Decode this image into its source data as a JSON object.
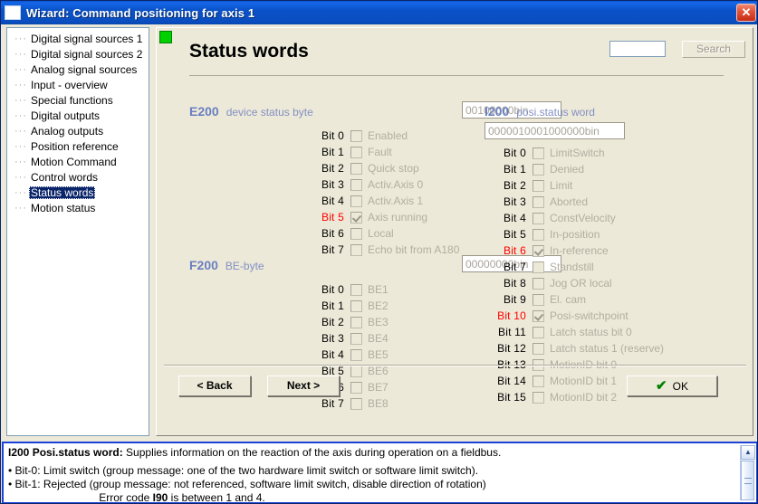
{
  "window": {
    "title": "Wizard: Command positioning for axis 1",
    "close_label": "✕"
  },
  "sidebar": {
    "items": [
      {
        "label": "Digital signal sources 1",
        "selected": false
      },
      {
        "label": "Digital signal sources 2",
        "selected": false
      },
      {
        "label": "Analog signal sources",
        "selected": false
      },
      {
        "label": "Input - overview",
        "selected": false
      },
      {
        "label": "Special functions",
        "selected": false
      },
      {
        "label": "Digital outputs",
        "selected": false
      },
      {
        "label": "Analog outputs",
        "selected": false
      },
      {
        "label": "Position reference",
        "selected": false
      },
      {
        "label": "Motion Command",
        "selected": false
      },
      {
        "label": "Control words",
        "selected": false
      },
      {
        "label": "Status words",
        "selected": true
      },
      {
        "label": "Motion status",
        "selected": false
      }
    ]
  },
  "page": {
    "title": "Status words",
    "led_color": "#00d000",
    "search": {
      "value": "",
      "button_label": "Search"
    }
  },
  "groups": {
    "e200": {
      "code": "E200",
      "description": "device status byte",
      "value": "00100000bin",
      "bits": [
        {
          "label": "Bit  0",
          "name": "Enabled",
          "checked": false,
          "highlight": false
        },
        {
          "label": "Bit  1",
          "name": "Fault",
          "checked": false,
          "highlight": false
        },
        {
          "label": "Bit  2",
          "name": "Quick stop",
          "checked": false,
          "highlight": false
        },
        {
          "label": "Bit  3",
          "name": "Activ.Axis 0",
          "checked": false,
          "highlight": false
        },
        {
          "label": "Bit  4",
          "name": "Activ.Axis 1",
          "checked": false,
          "highlight": false
        },
        {
          "label": "Bit  5",
          "name": "Axis running",
          "checked": true,
          "highlight": true
        },
        {
          "label": "Bit  6",
          "name": "Local",
          "checked": false,
          "highlight": false
        },
        {
          "label": "Bit  7",
          "name": "Echo bit from A180",
          "checked": false,
          "highlight": false
        }
      ]
    },
    "f200": {
      "code": "F200",
      "description": "BE-byte",
      "value": "00000000bin",
      "bits": [
        {
          "label": "Bit  0",
          "name": "BE1",
          "checked": false,
          "highlight": false
        },
        {
          "label": "Bit  1",
          "name": "BE2",
          "checked": false,
          "highlight": false
        },
        {
          "label": "Bit  2",
          "name": "BE3",
          "checked": false,
          "highlight": false
        },
        {
          "label": "Bit  3",
          "name": "BE4",
          "checked": false,
          "highlight": false
        },
        {
          "label": "Bit  4",
          "name": "BE5",
          "checked": false,
          "highlight": false
        },
        {
          "label": "Bit  5",
          "name": "BE6",
          "checked": false,
          "highlight": false
        },
        {
          "label": "Bit  6",
          "name": "BE7",
          "checked": false,
          "highlight": false
        },
        {
          "label": "Bit  7",
          "name": "BE8",
          "checked": false,
          "highlight": false
        }
      ]
    },
    "i200": {
      "code": "I200",
      "description": "posi.status word",
      "value": "0000010001000000bin",
      "bits": [
        {
          "label": "Bit  0",
          "name": "LimitSwitch",
          "checked": false,
          "highlight": false
        },
        {
          "label": "Bit  1",
          "name": "Denied",
          "checked": false,
          "highlight": false
        },
        {
          "label": "Bit  2",
          "name": "Limit",
          "checked": false,
          "highlight": false
        },
        {
          "label": "Bit  3",
          "name": "Aborted",
          "checked": false,
          "highlight": false
        },
        {
          "label": "Bit  4",
          "name": "ConstVelocity",
          "checked": false,
          "highlight": false
        },
        {
          "label": "Bit  5",
          "name": "In-position",
          "checked": false,
          "highlight": false
        },
        {
          "label": "Bit  6",
          "name": "In-reference",
          "checked": true,
          "highlight": true
        },
        {
          "label": "Bit  7",
          "name": "Standstill",
          "checked": false,
          "highlight": false
        },
        {
          "label": "Bit  8",
          "name": "Jog OR local",
          "checked": false,
          "highlight": false
        },
        {
          "label": "Bit  9",
          "name": "El. cam",
          "checked": false,
          "highlight": false
        },
        {
          "label": "Bit 10",
          "name": "Posi-switchpoint",
          "checked": true,
          "highlight": true
        },
        {
          "label": "Bit 11",
          "name": "Latch status bit 0",
          "checked": false,
          "highlight": false
        },
        {
          "label": "Bit 12",
          "name": "Latch status 1 (reserve)",
          "checked": false,
          "highlight": false
        },
        {
          "label": "Bit 13",
          "name": "MotionID bit 0",
          "checked": false,
          "highlight": false
        },
        {
          "label": "Bit 14",
          "name": "MotionID bit 1",
          "checked": false,
          "highlight": false
        },
        {
          "label": "Bit 15",
          "name": "MotionID bit 2",
          "checked": false,
          "highlight": false
        }
      ]
    }
  },
  "footer": {
    "back_label": "< Back",
    "next_label": "Next >",
    "ok_label": "OK",
    "ok_icon": "✔"
  },
  "help": {
    "heading_code": "I200  Posi.status word:",
    "heading_text": " Supplies information on the reaction of the axis during operation on a fieldbus.",
    "line_bit0": "• Bit-0: Limit switch (group message: one of the two hardware limit switch or software limit switch).",
    "line_bit1": "• Bit-1: Rejected (group message: not referenced, software limit switch, disable direction of rotation)",
    "line_error_pre": "Error code ",
    "line_error_code": "I90",
    "line_error_post": " is between 1 and 4."
  },
  "colors": {
    "titlebar": "#0a51c8",
    "accent_code": "#6a7fc0",
    "highlight_bit": "#ff0000",
    "selection": "#0a246a",
    "face": "#ece9d8"
  }
}
